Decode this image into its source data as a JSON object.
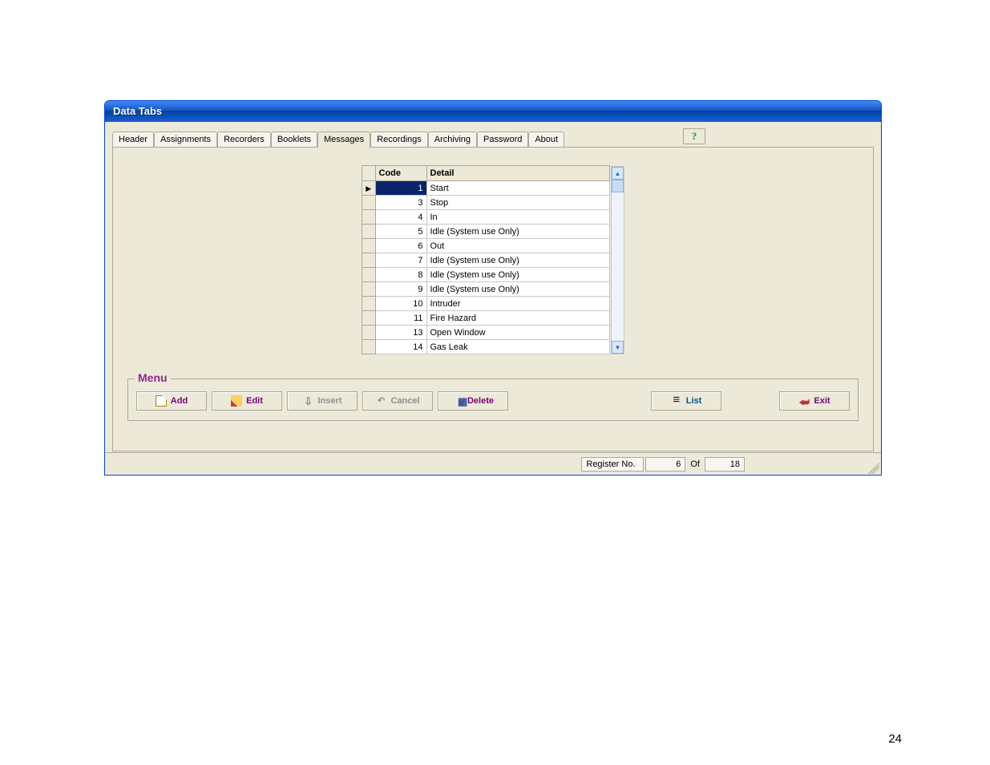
{
  "window": {
    "title": "Data Tabs"
  },
  "tabs": [
    {
      "label": "Header"
    },
    {
      "label": "Assignments"
    },
    {
      "label": "Recorders"
    },
    {
      "label": "Booklets"
    },
    {
      "label": "Messages",
      "active": true
    },
    {
      "label": "Recordings"
    },
    {
      "label": "Archiving"
    },
    {
      "label": "Password"
    },
    {
      "label": "About"
    }
  ],
  "help": {
    "label": "?"
  },
  "grid": {
    "columns": {
      "code": "Code",
      "detail": "Detail"
    },
    "rows": [
      {
        "code": "1",
        "detail": "Start",
        "selected": true
      },
      {
        "code": "3",
        "detail": "Stop"
      },
      {
        "code": "4",
        "detail": "In"
      },
      {
        "code": "5",
        "detail": "Idle (System use Only)"
      },
      {
        "code": "6",
        "detail": "Out"
      },
      {
        "code": "7",
        "detail": "Idle (System use Only)"
      },
      {
        "code": "8",
        "detail": "Idle (System use Only)"
      },
      {
        "code": "9",
        "detail": "Idle (System use Only)"
      },
      {
        "code": "10",
        "detail": "Intruder"
      },
      {
        "code": "11",
        "detail": "Fire Hazard"
      },
      {
        "code": "13",
        "detail": "Open Window"
      },
      {
        "code": "14",
        "detail": "Gas Leak"
      }
    ]
  },
  "menu": {
    "legend": "Menu",
    "add": "Add",
    "edit": "Edit",
    "insert": "Insert",
    "cancel": "Cancel",
    "delete": "Delete",
    "list": "List",
    "exit": "Exit"
  },
  "status": {
    "register_label": "Register No.",
    "register_value": "6",
    "of_label": "Of",
    "total": "18"
  },
  "page_number": "24"
}
